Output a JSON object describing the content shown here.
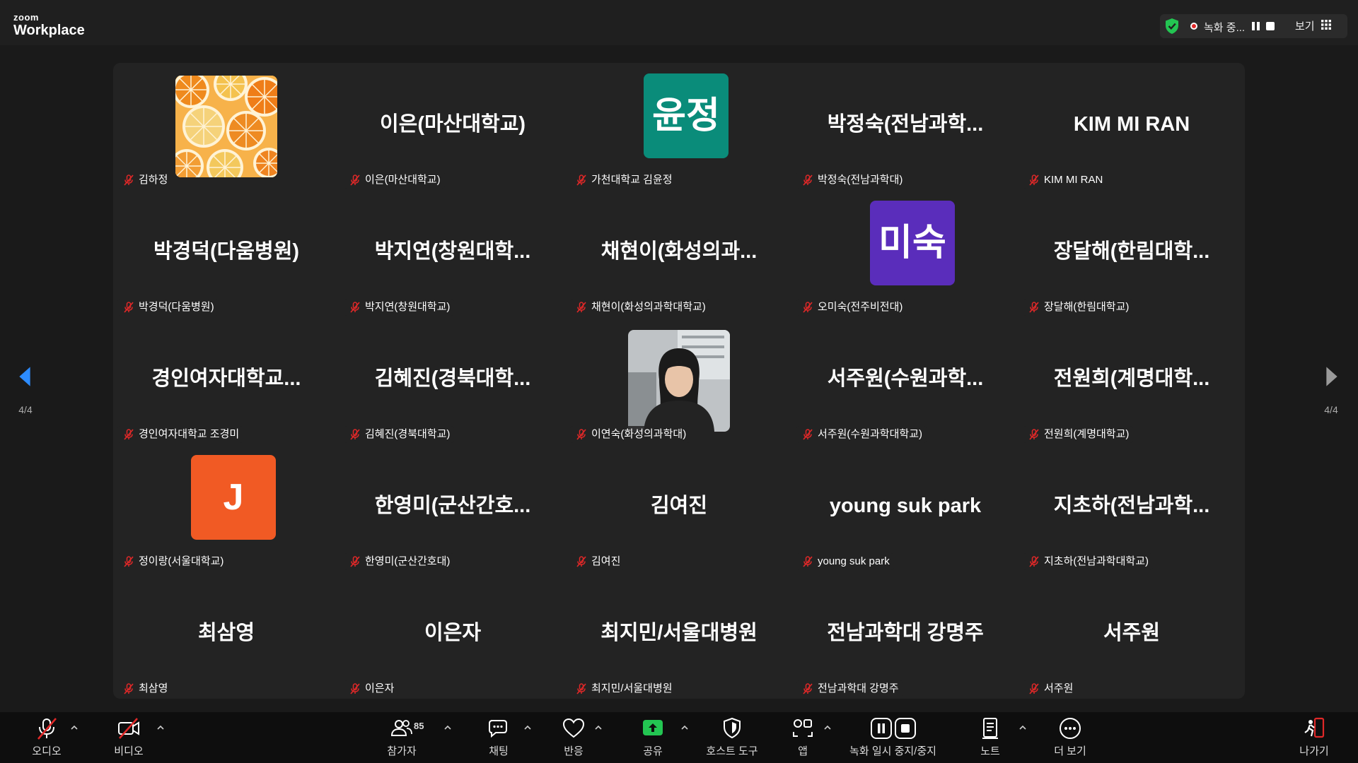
{
  "app": {
    "logo_top": "zoom",
    "logo_bottom": "Workplace"
  },
  "recording": {
    "status": "녹화 중...",
    "view_label": "보기"
  },
  "gallery": {
    "page_indicator_left": "4/4",
    "page_indicator_right": "4/4",
    "participants": [
      {
        "display": "",
        "label": "김하정",
        "photo": "citrus-slices"
      },
      {
        "display": "이은(마산대학교)",
        "label": "이은(마산대학교)"
      },
      {
        "display": "윤정",
        "label": "가천대학교 김윤정",
        "avatar_color": "#0a8c7a"
      },
      {
        "display": "박정숙(전남과학...",
        "label": "박정숙(전남과학대)"
      },
      {
        "display": "KIM MI RAN",
        "label": "KIM MI RAN"
      },
      {
        "display": "박경덕(다움병원)",
        "label": "박경덕(다움병원)"
      },
      {
        "display": "박지연(창원대학...",
        "label": "박지연(창원대학교)"
      },
      {
        "display": "채현이(화성의과...",
        "label": "채현이(화성의과학대학교)"
      },
      {
        "display": "미숙",
        "label": "오미숙(전주비전대)",
        "avatar_color": "#5a2dbb"
      },
      {
        "display": "장달해(한림대학...",
        "label": "장달해(한림대학교)"
      },
      {
        "display": "경인여자대학교...",
        "label": "경인여자대학교 조경미"
      },
      {
        "display": "김혜진(경북대학...",
        "label": "김혜진(경북대학교)"
      },
      {
        "display": "",
        "label": "이연숙(화성의과학대)",
        "photo": "person-portrait"
      },
      {
        "display": "서주원(수원과학...",
        "label": "서주원(수원과학대학교)"
      },
      {
        "display": "전원희(계명대학...",
        "label": "전원희(계명대학교)"
      },
      {
        "display": "J",
        "label": "정이랑(서울대학교)",
        "avatar_color": "#f15a24"
      },
      {
        "display": "한영미(군산간호...",
        "label": "한영미(군산간호대)"
      },
      {
        "display": "김여진",
        "label": "김여진"
      },
      {
        "display": "young suk park",
        "label": "young suk park"
      },
      {
        "display": "지초하(전남과학...",
        "label": "지초하(전남과학대학교)"
      },
      {
        "display": "최삼영",
        "label": "최삼영"
      },
      {
        "display": "이은자",
        "label": "이은자"
      },
      {
        "display": "최지민/서울대병원",
        "label": "최지민/서울대병원"
      },
      {
        "display": "전남과학대 강명주",
        "label": "전남과학대 강명주"
      },
      {
        "display": "서주원",
        "label": "서주원"
      }
    ]
  },
  "toolbar": {
    "audio": "오디오",
    "video": "비디오",
    "participants": "참가자",
    "participant_count": "85",
    "chat": "채팅",
    "reactions": "반응",
    "share": "공유",
    "host_tools": "호스트 도구",
    "apps": "앱",
    "recording": "녹화 일시 중지/중지",
    "notes": "노트",
    "more": "더 보기",
    "leave": "나가기"
  },
  "colors": {
    "accent_blue": "#2d8cff",
    "share_green": "#23c552",
    "leave_red": "#e02828",
    "mic_off_red": "#e02828"
  }
}
